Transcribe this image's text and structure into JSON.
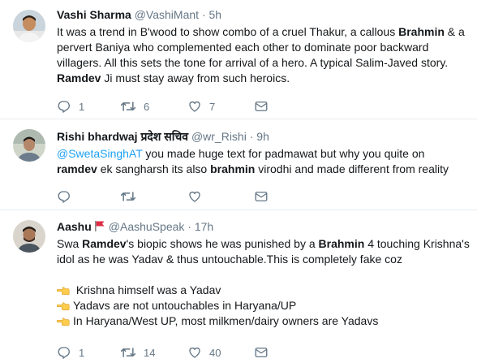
{
  "tweets": [
    {
      "name": "Vashi Sharma",
      "handle": "@VashiMant",
      "time": "5h",
      "lines": [
        [
          {
            "t": "It was a trend in B'wood to show combo of a cruel Thakur, a callous "
          },
          {
            "t": "Brahmin",
            "b": true
          },
          {
            "t": " & a"
          }
        ],
        [
          {
            "t": "pervert Baniya who complemented each other to dominate poor backward"
          }
        ],
        [
          {
            "t": "villagers. All this sets the tone for arrival of a hero. A typical Salim-Javed story."
          }
        ],
        [
          {
            "t": "Ramdev",
            "b": true
          },
          {
            "t": " Ji must stay away from such heroics."
          }
        ]
      ],
      "reply_count": "1",
      "retweet_count": "6",
      "like_count": "7"
    },
    {
      "name": "Rishi bhardwaj प्रदेश सचिव",
      "handle": "@wr_Rishi",
      "time": "9h",
      "lines": [
        [
          {
            "t": "@SwetaSinghAT",
            "m": true
          },
          {
            "t": " you made huge text for padmawat but why you quite on"
          }
        ],
        [
          {
            "t": "ramdev",
            "b": true
          },
          {
            "t": " ek sangharsh its also "
          },
          {
            "t": "brahmin",
            "b": true
          },
          {
            "t": " virodhi and made different from reality"
          }
        ]
      ],
      "reply_count": "",
      "retweet_count": "",
      "like_count": ""
    },
    {
      "name": "Aashu",
      "handle": "@AashuSpeak",
      "time": "17h",
      "lines": [
        [
          {
            "t": "Swa "
          },
          {
            "t": "Ramdev",
            "b": true
          },
          {
            "t": "'s biopic shows he was punished by a "
          },
          {
            "t": "Brahmin",
            "b": true
          },
          {
            "t": " 4 touching Krishna's"
          }
        ],
        [
          {
            "t": "idol as he was Yadav & thus untouchable.This is completely fake coz"
          }
        ],
        [
          {
            "t": " "
          }
        ],
        [
          {
            "p": true
          },
          {
            "t": " Krishna himself was a Yadav"
          }
        ],
        [
          {
            "p": true
          },
          {
            "t": "Yadavs are not untouchables in Haryana/UP"
          }
        ],
        [
          {
            "p": true
          },
          {
            "t": "In Haryana/West UP, most milkmen/dairy owners are Yadavs"
          }
        ]
      ],
      "reply_count": "1",
      "retweet_count": "14",
      "like_count": "40"
    }
  ],
  "separator": "·",
  "icons": {
    "reply": "reply-icon",
    "retweet": "retweet-icon",
    "like": "heart-icon",
    "dm": "envelope-icon",
    "flag": "red-flag-icon",
    "pointing": "pointing-hand-emoji"
  },
  "colors": {
    "text": "#14171a",
    "secondary": "#657786",
    "link": "#1da1f2",
    "border": "#e6ecf0"
  }
}
